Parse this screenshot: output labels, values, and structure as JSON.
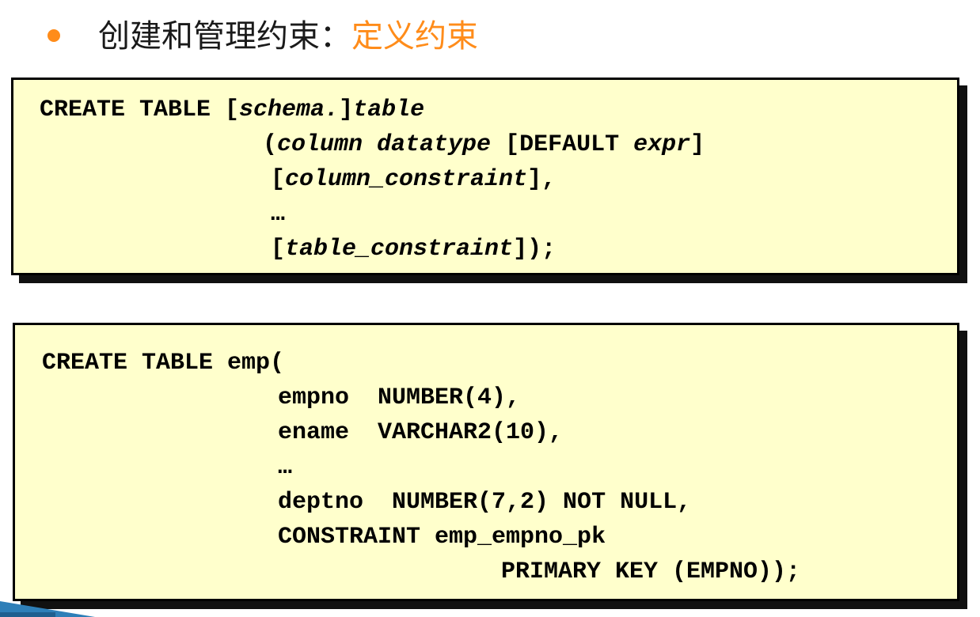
{
  "heading": {
    "prefix": "创建和管理约束：",
    "accent": "定义约束",
    "accent_color": "#ff8c1a"
  },
  "syntax_box": {
    "lines": [
      {
        "segments": [
          {
            "t": "CREATE TABLE [",
            "i": false
          },
          {
            "t": "schema.",
            "i": true
          },
          {
            "t": "]",
            "i": false
          },
          {
            "t": "table",
            "i": true
          }
        ]
      },
      {
        "segments": [
          {
            "t": "(",
            "i": false
          },
          {
            "t": "column datatype",
            "i": true
          },
          {
            "t": " [DEFAULT ",
            "i": false
          },
          {
            "t": "expr",
            "i": true
          },
          {
            "t": "]",
            "i": false
          }
        ]
      },
      {
        "segments": [
          {
            "t": "[",
            "i": false
          },
          {
            "t": "column_constraint",
            "i": true
          },
          {
            "t": "],",
            "i": false
          }
        ]
      },
      {
        "segments": [
          {
            "t": "…",
            "i": false
          }
        ]
      },
      {
        "segments": [
          {
            "t": "[",
            "i": false
          },
          {
            "t": "table_constraint",
            "i": true
          },
          {
            "t": "]);",
            "i": false
          }
        ]
      }
    ]
  },
  "example_box": {
    "lines": [
      "CREATE TABLE emp(",
      "empno  NUMBER(4),",
      "ename  VARCHAR2(10),",
      "…",
      "deptno  NUMBER(7,2) NOT NULL,",
      "CONSTRAINT emp_empno_pk",
      "PRIMARY KEY (EMPNO));"
    ]
  }
}
